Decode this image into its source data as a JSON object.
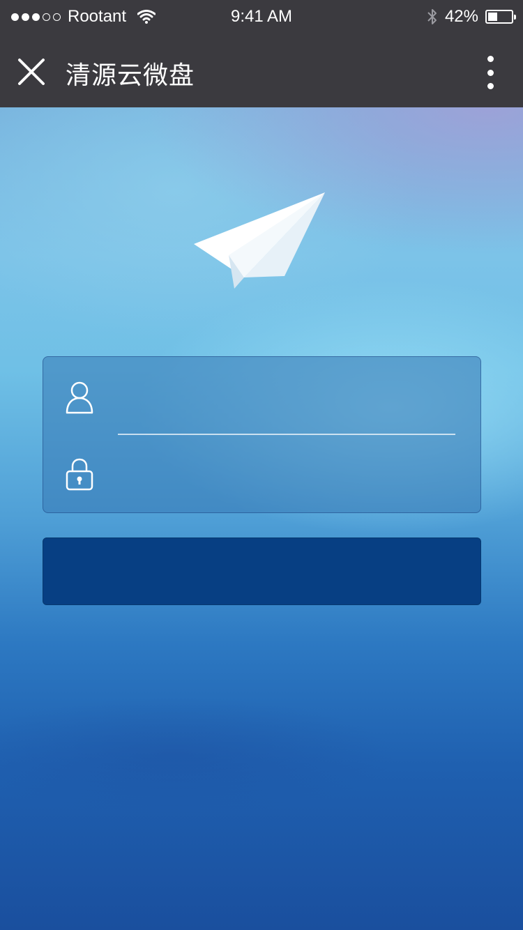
{
  "status_bar": {
    "carrier": "Rootant",
    "signal_bars_filled": 3,
    "signal_bars_total": 5,
    "time": "9:41 AM",
    "battery_percent": "42%",
    "battery_level": 0.42,
    "icons": [
      "wifi-icon",
      "bluetooth-icon",
      "battery-icon"
    ]
  },
  "navbar": {
    "title": "清源云微盘",
    "close_icon": "close-icon",
    "more_icon": "more-vertical-icon"
  },
  "form": {
    "username": {
      "value": "",
      "placeholder": "",
      "icon": "user-icon"
    },
    "password": {
      "value": "",
      "placeholder": "",
      "icon": "lock-icon"
    }
  },
  "login_button": {
    "label": ""
  },
  "secondary_link": {
    "label": ""
  },
  "colors": {
    "top_bar": "#3b3a3f",
    "button": "#073f83",
    "card": "#3678b4"
  }
}
